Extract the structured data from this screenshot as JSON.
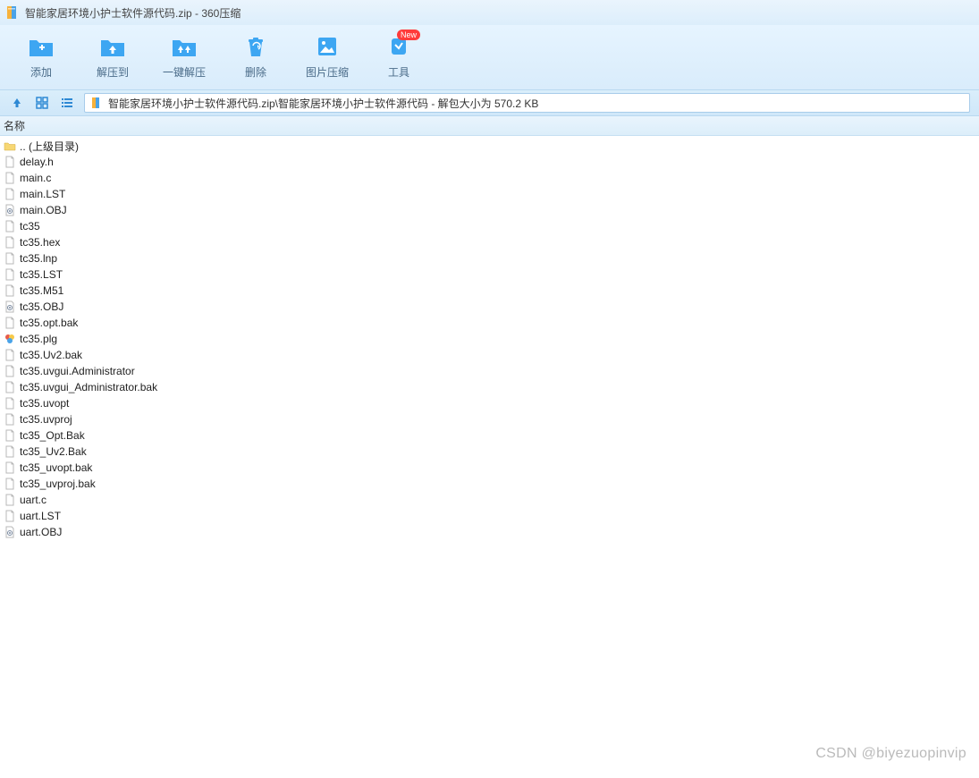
{
  "title": "智能家居环境小护士软件源代码.zip - 360压缩",
  "toolbar": [
    {
      "icon": "add",
      "label": "添加"
    },
    {
      "icon": "extract",
      "label": "解压到"
    },
    {
      "icon": "oneclick",
      "label": "一键解压"
    },
    {
      "icon": "delete",
      "label": "删除"
    },
    {
      "icon": "imgcompress",
      "label": "图片压缩"
    },
    {
      "icon": "tools",
      "label": "工具",
      "badge": "New"
    }
  ],
  "path": "智能家居环境小护士软件源代码.zip\\智能家居环境小护士软件源代码 - 解包大小为 570.2 KB",
  "columns": {
    "name": "名称"
  },
  "files": [
    {
      "icon": "folder-up",
      "name": ".. (上级目录)"
    },
    {
      "icon": "file",
      "name": "delay.h"
    },
    {
      "icon": "file",
      "name": "main.c"
    },
    {
      "icon": "file",
      "name": "main.LST"
    },
    {
      "icon": "obj",
      "name": "main.OBJ"
    },
    {
      "icon": "file",
      "name": "tc35"
    },
    {
      "icon": "file",
      "name": "tc35.hex"
    },
    {
      "icon": "file",
      "name": "tc35.lnp"
    },
    {
      "icon": "file",
      "name": "tc35.LST"
    },
    {
      "icon": "file",
      "name": "tc35.M51"
    },
    {
      "icon": "obj",
      "name": "tc35.OBJ"
    },
    {
      "icon": "file",
      "name": "tc35.opt.bak"
    },
    {
      "icon": "plg",
      "name": "tc35.plg"
    },
    {
      "icon": "file",
      "name": "tc35.Uv2.bak"
    },
    {
      "icon": "file",
      "name": "tc35.uvgui.Administrator"
    },
    {
      "icon": "file",
      "name": "tc35.uvgui_Administrator.bak"
    },
    {
      "icon": "file",
      "name": "tc35.uvopt"
    },
    {
      "icon": "file",
      "name": "tc35.uvproj"
    },
    {
      "icon": "file",
      "name": "tc35_Opt.Bak"
    },
    {
      "icon": "file",
      "name": "tc35_Uv2.Bak"
    },
    {
      "icon": "file",
      "name": "tc35_uvopt.bak"
    },
    {
      "icon": "file",
      "name": "tc35_uvproj.bak"
    },
    {
      "icon": "file",
      "name": "uart.c"
    },
    {
      "icon": "file",
      "name": "uart.LST"
    },
    {
      "icon": "obj",
      "name": "uart.OBJ"
    }
  ],
  "watermark": "CSDN @biyezuopinvip"
}
